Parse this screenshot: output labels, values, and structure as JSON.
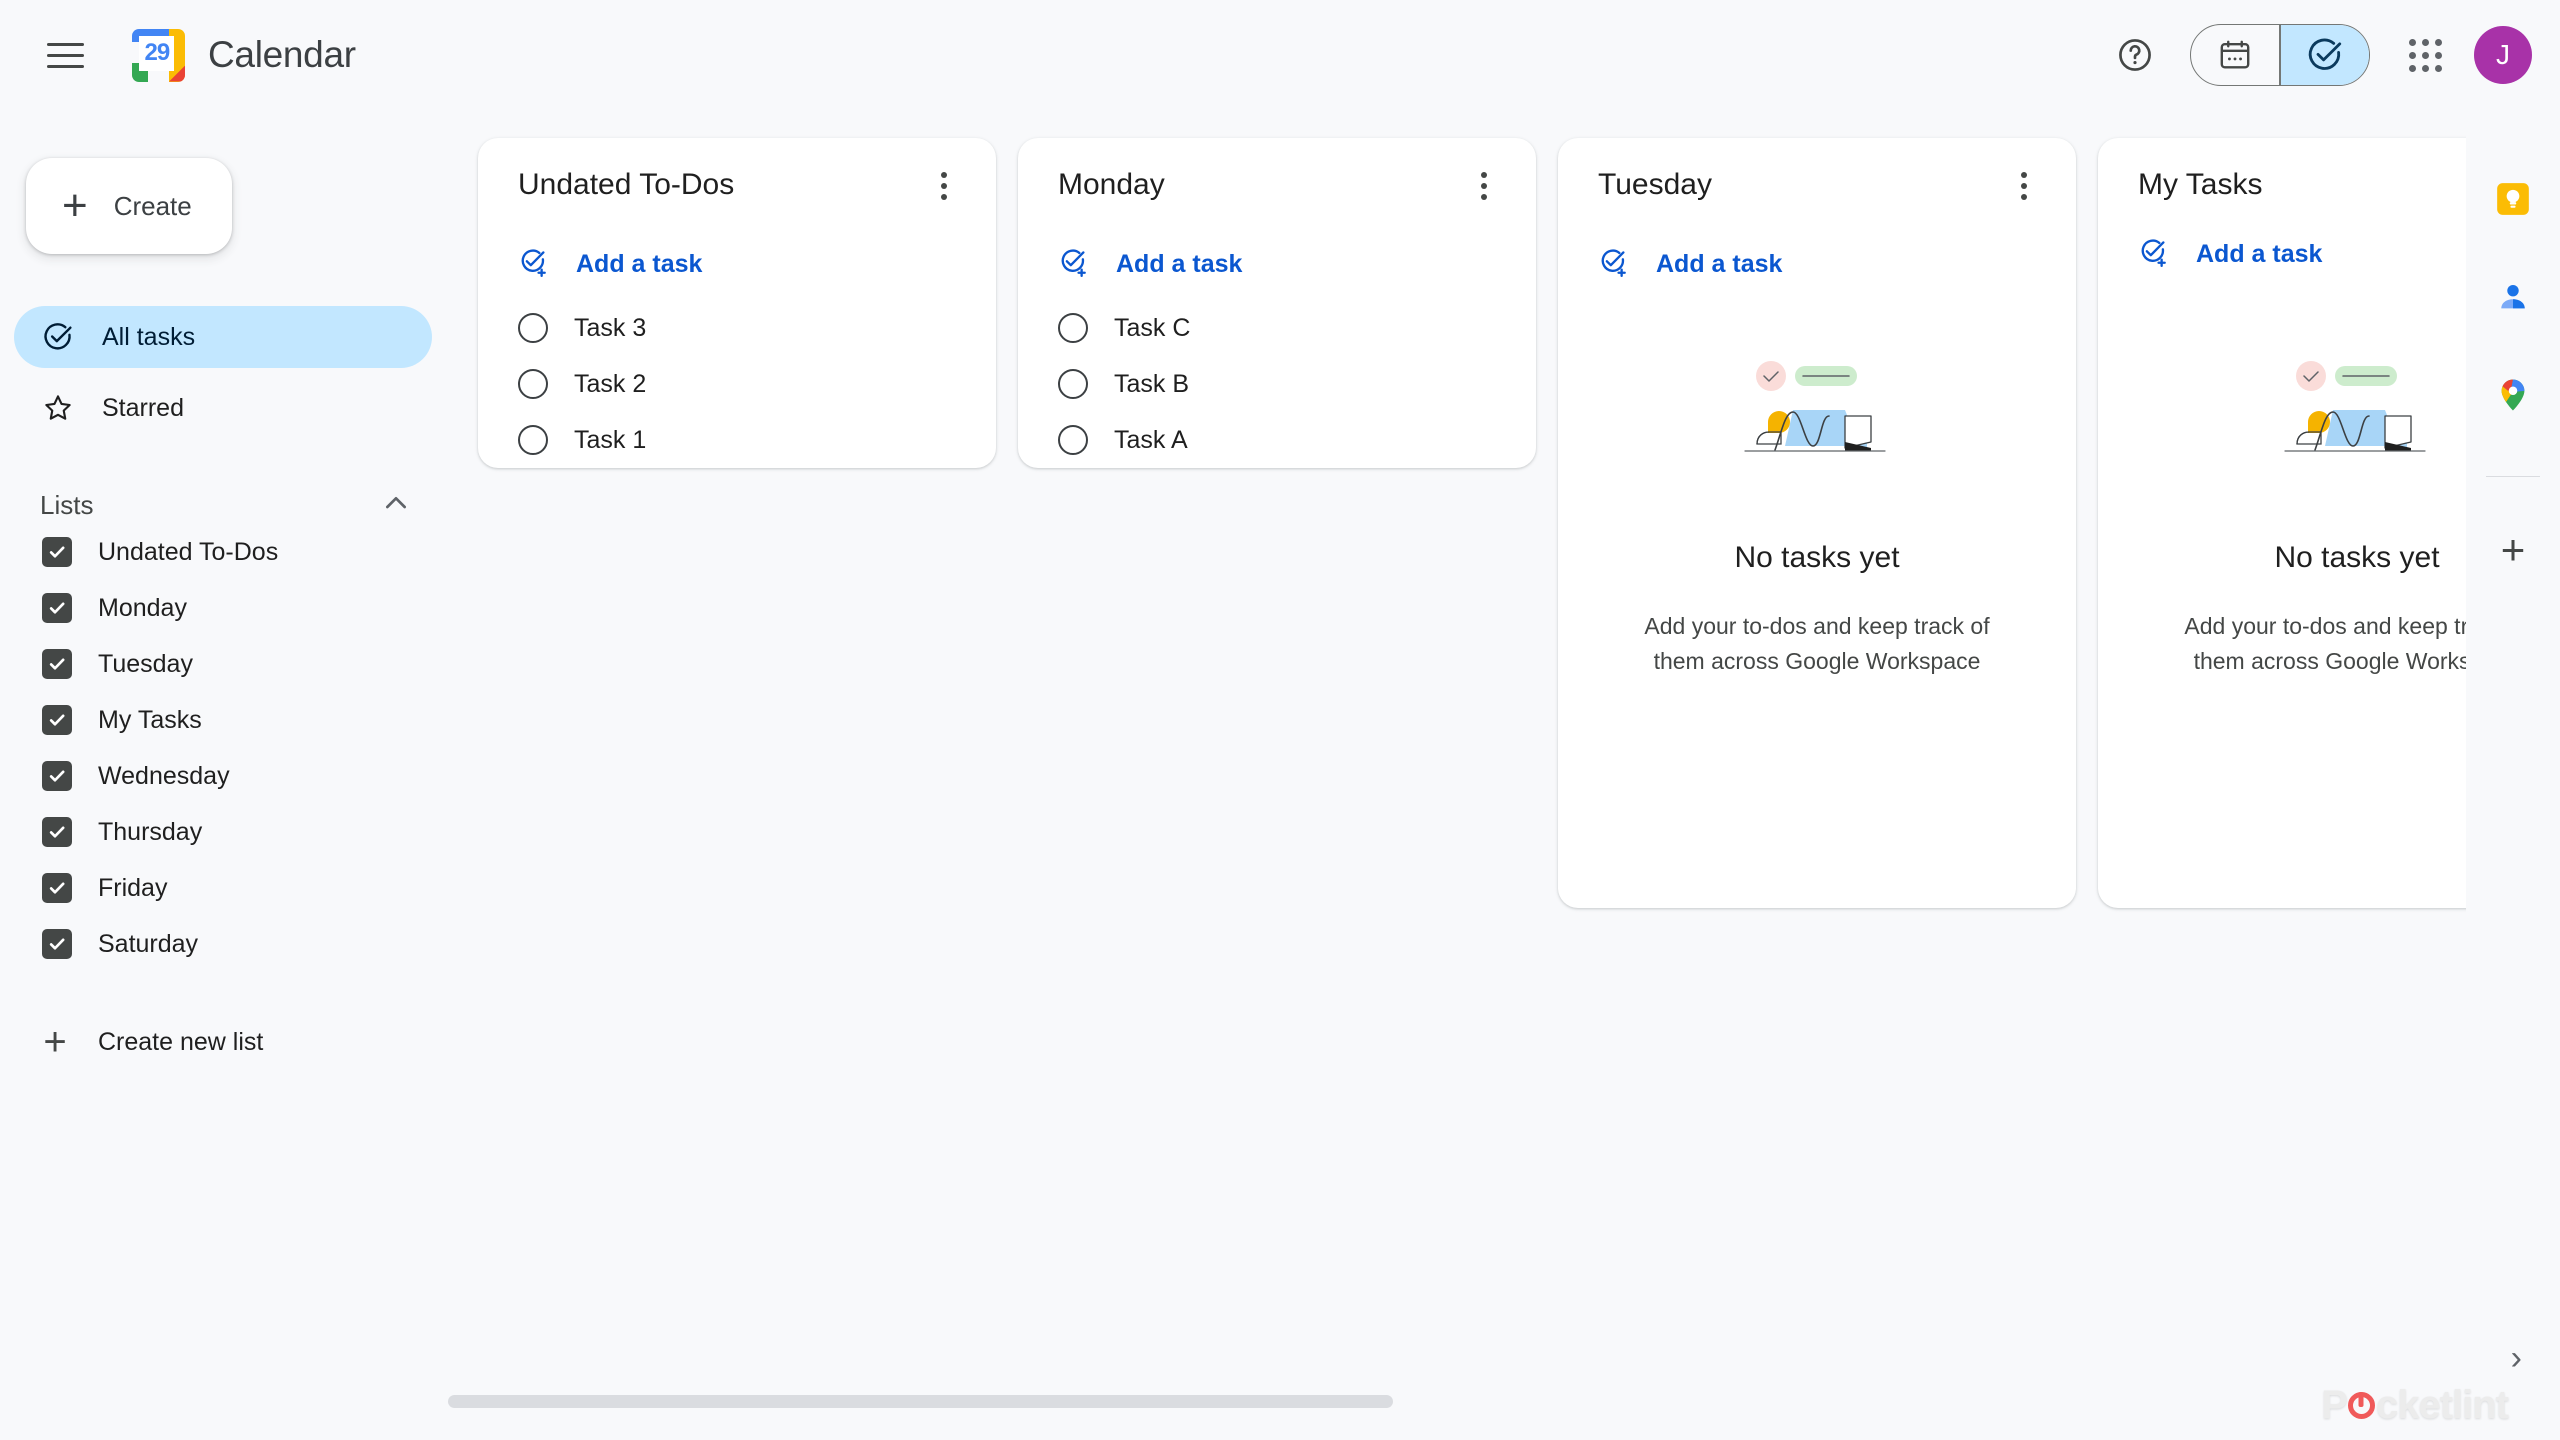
{
  "header": {
    "menu_icon": "hamburger-icon",
    "logo_day": "29",
    "app_title": "Calendar",
    "help_icon": "help-circle-icon",
    "calendar_view_icon": "calendar-icon",
    "tasks_view_icon": "check-circle-icon",
    "apps_icon": "apps-grid-icon",
    "avatar_initial": "J"
  },
  "sidebar": {
    "create_label": "Create",
    "nav": [
      {
        "label": "All tasks",
        "icon": "check-circle-icon",
        "active": true
      },
      {
        "label": "Starred",
        "icon": "star-outline-icon",
        "active": false
      }
    ],
    "lists_header": "Lists",
    "collapse_icon": "chevron-up-icon",
    "lists": [
      {
        "label": "Undated To-Dos",
        "checked": true
      },
      {
        "label": "Monday",
        "checked": true
      },
      {
        "label": "Tuesday",
        "checked": true
      },
      {
        "label": "My Tasks",
        "checked": true
      },
      {
        "label": "Wednesday",
        "checked": true
      },
      {
        "label": "Thursday",
        "checked": true
      },
      {
        "label": "Friday",
        "checked": true
      },
      {
        "label": "Saturday",
        "checked": true
      }
    ],
    "create_list_label": "Create new list",
    "create_list_icon": "plus-icon"
  },
  "board": {
    "add_task_label": "Add a task",
    "empty_title": "No tasks yet",
    "empty_subtitle": "Add your to-dos and keep track of them across Google Workspace",
    "cards": [
      {
        "title": "Undated To-Dos",
        "tasks": [
          "Task 3",
          "Task 2",
          "Task 1"
        ]
      },
      {
        "title": "Monday",
        "tasks": [
          "Task C",
          "Task B",
          "Task A"
        ]
      },
      {
        "title": "Tuesday",
        "tasks": []
      },
      {
        "title": "My Tasks",
        "tasks": []
      }
    ]
  },
  "rail": {
    "items": [
      {
        "name": "google-keep-icon",
        "label": "Keep"
      },
      {
        "name": "google-contacts-icon",
        "label": "Contacts"
      },
      {
        "name": "google-maps-icon",
        "label": "Maps"
      }
    ],
    "add_icon": "plus-icon"
  },
  "misc": {
    "expand_chevron": "›",
    "watermark": "Pocketlint",
    "watermark_pre": "P",
    "watermark_post": "cketlint"
  },
  "colors": {
    "accent_blue": "#0b57d0",
    "selected_blue": "#c2e7ff",
    "avatar_purple": "#a832a8",
    "page_bg": "#f8f9fb",
    "card_bg": "#ffffff",
    "text_primary": "#1f1f1f",
    "text_secondary": "#444746"
  }
}
